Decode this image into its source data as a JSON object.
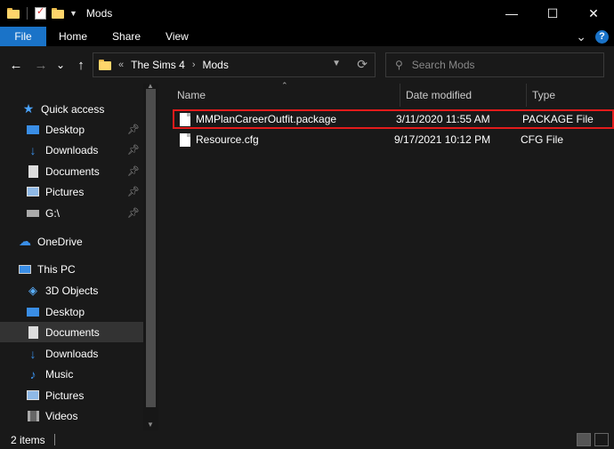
{
  "window": {
    "title": "Mods",
    "minimize_glyph": "—",
    "maximize_glyph": "☐",
    "close_glyph": "✕"
  },
  "ribbon": {
    "tabs": [
      "File",
      "Home",
      "Share",
      "View"
    ],
    "expand_glyph": "⌄",
    "help_glyph": "?"
  },
  "nav_buttons": {
    "back": "←",
    "forward": "→",
    "recent": "⌄",
    "up": "↑"
  },
  "address": {
    "overflow": "«",
    "crumbs": [
      "The Sims 4",
      "Mods"
    ],
    "separator": "›"
  },
  "search": {
    "placeholder": "Search Mods"
  },
  "nav_pane": {
    "quick_access": "Quick access",
    "quick_items": [
      "Desktop",
      "Downloads",
      "Documents",
      "Pictures",
      "G:\\"
    ],
    "onedrive": "OneDrive",
    "this_pc": "This PC",
    "pc_items": [
      "3D Objects",
      "Desktop",
      "Documents",
      "Downloads",
      "Music",
      "Pictures",
      "Videos"
    ],
    "selected": "Documents"
  },
  "columns": {
    "name": "Name",
    "date": "Date modified",
    "type": "Type"
  },
  "files": [
    {
      "name": "MMPlanCareerOutfit.package",
      "date": "3/11/2020 11:55 AM",
      "type": "PACKAGE File"
    },
    {
      "name": "Resource.cfg",
      "date": "9/17/2021 10:12 PM",
      "type": "CFG File"
    }
  ],
  "status": {
    "item_count": "2 items"
  },
  "colors": {
    "accent": "#1a73c8",
    "highlight_border": "#e31b1b",
    "folder": "#ffd56b"
  }
}
